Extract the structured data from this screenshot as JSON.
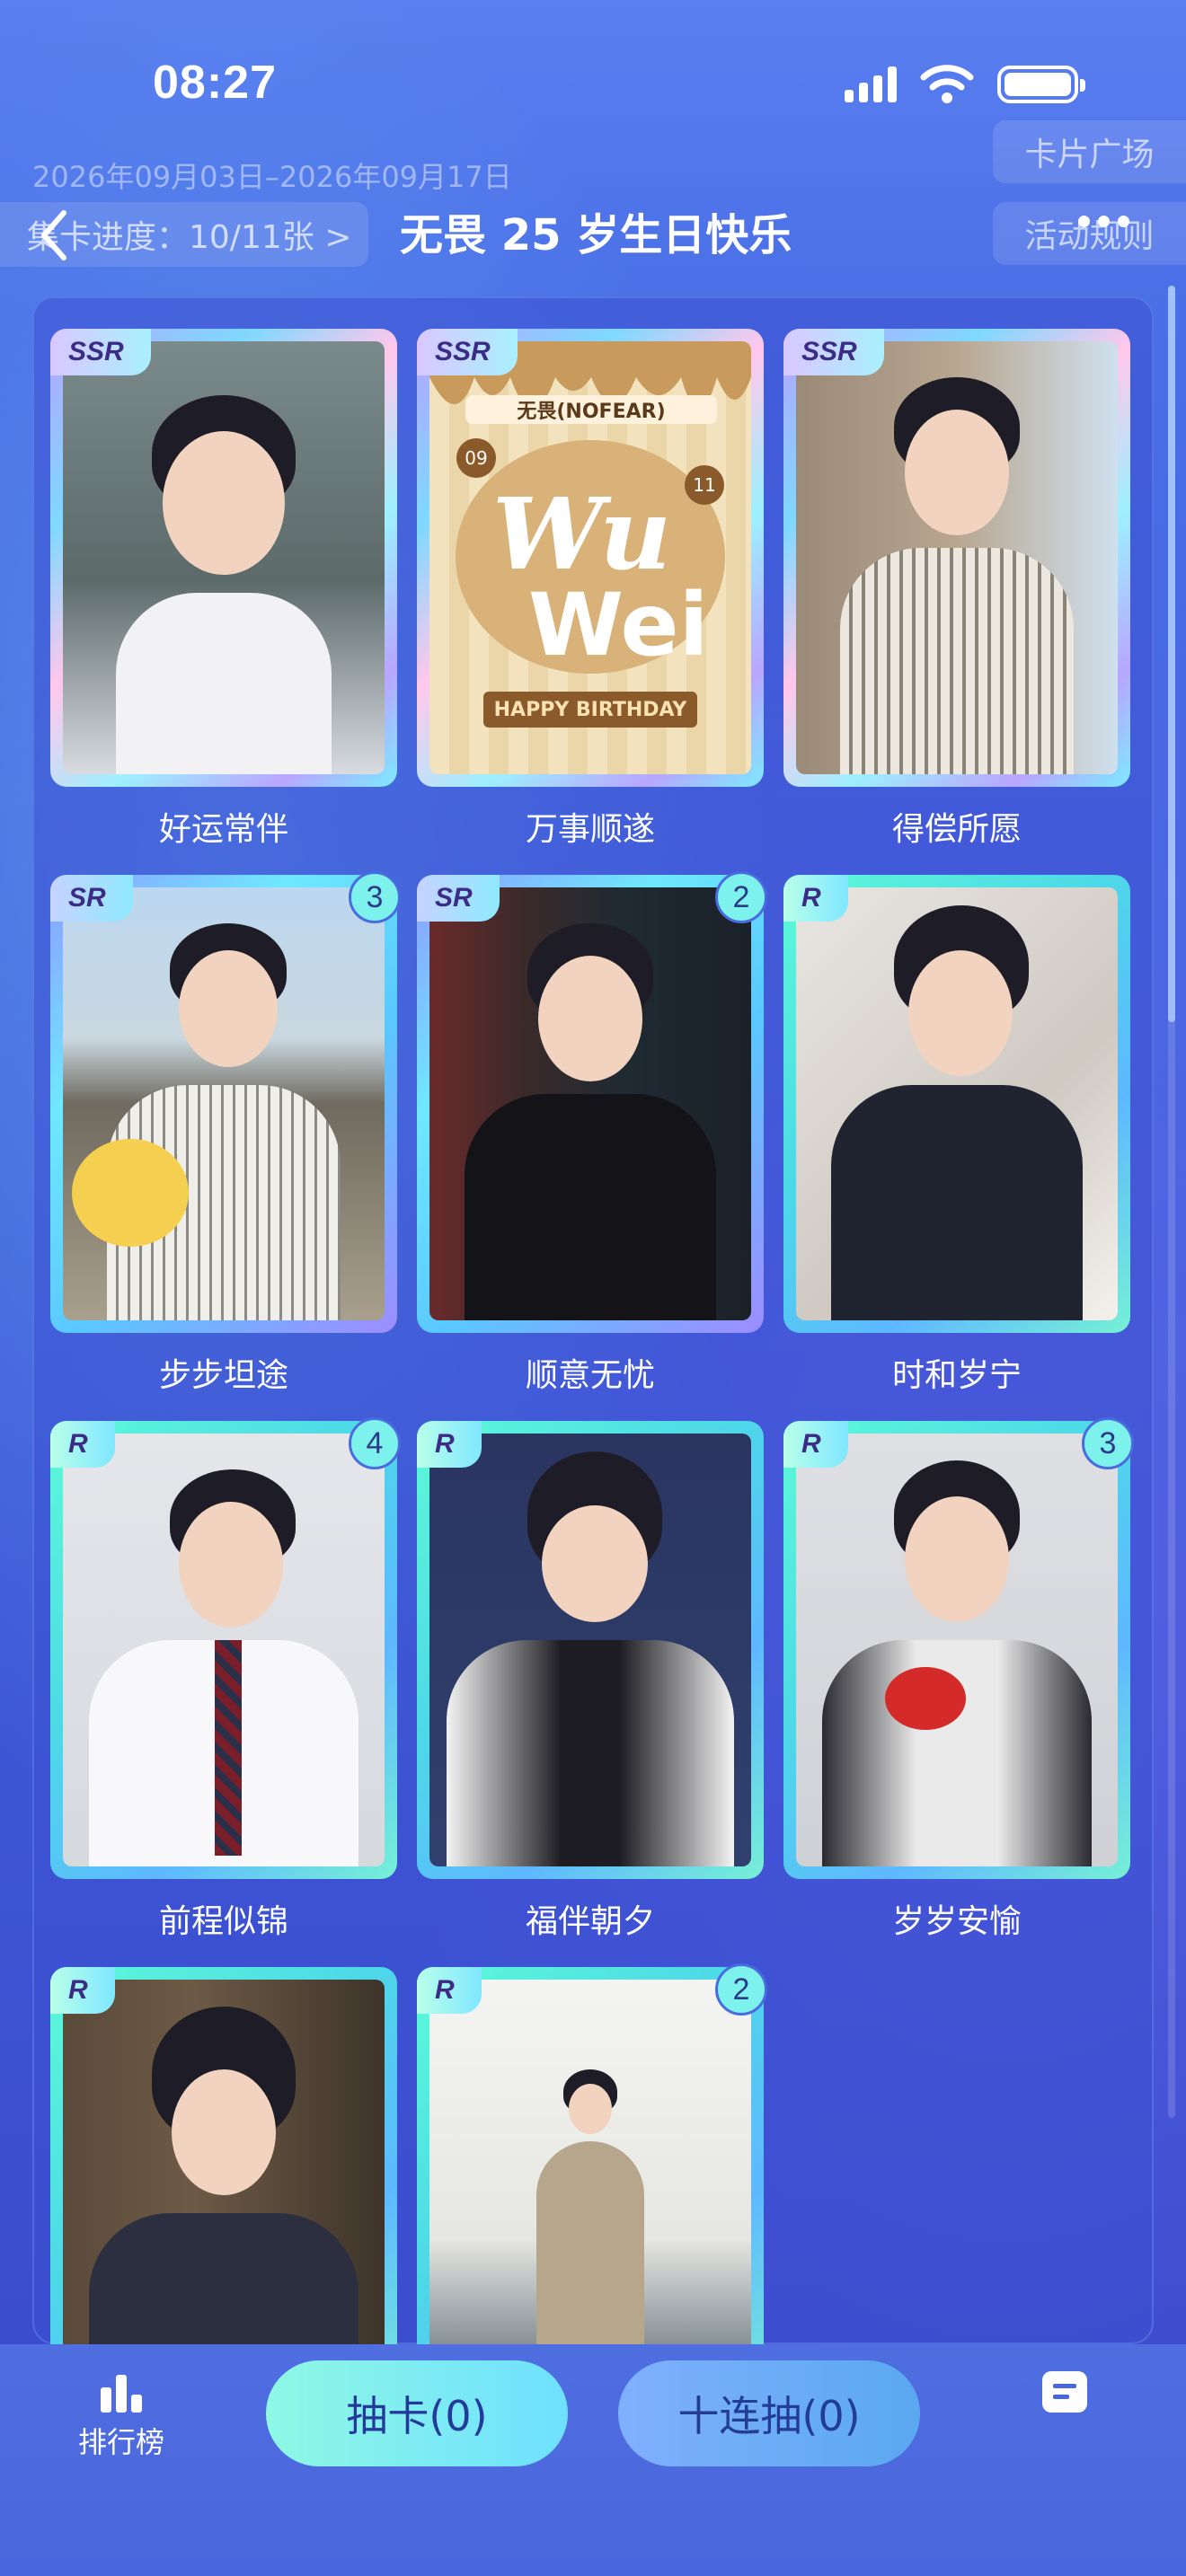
{
  "status": {
    "time": "08:27"
  },
  "header": {
    "date_range": "2026年09月03日–2026年09月17日",
    "progress": "集卡进度：10/11张 >",
    "title": "无畏 25 岁生日快乐",
    "plaza": "卡片广场",
    "rules": "活动规则"
  },
  "cards": [
    {
      "name": "好运常伴",
      "rarity": "SSR",
      "count": ""
    },
    {
      "name": "万事顺遂",
      "rarity": "SSR",
      "count": ""
    },
    {
      "name": "得偿所愿",
      "rarity": "SSR",
      "count": ""
    },
    {
      "name": "步步坦途",
      "rarity": "SR",
      "count": "3"
    },
    {
      "name": "顺意无忧",
      "rarity": "SR",
      "count": "2"
    },
    {
      "name": "时和岁宁",
      "rarity": "R",
      "count": ""
    },
    {
      "name": "前程似锦",
      "rarity": "R",
      "count": "4"
    },
    {
      "name": "福伴朝夕",
      "rarity": "R",
      "count": ""
    },
    {
      "name": "岁岁安愉",
      "rarity": "R",
      "count": "3"
    },
    {
      "name": "",
      "rarity": "R",
      "count": ""
    },
    {
      "name": "",
      "rarity": "R",
      "count": "2"
    }
  ],
  "special_card": {
    "top_text": "无畏(NOFEAR)",
    "num_left": "09",
    "num_right": "11",
    "word1": "Wu",
    "word2": "Wei",
    "banner": "HAPPY BIRTHDAY"
  },
  "bottom": {
    "rank_label": "排行榜",
    "draw_one": "抽卡(0)",
    "draw_ten": "十连抽(0)"
  },
  "colors": {
    "accent": "#7df2ec",
    "background": "#4a6fe6"
  },
  "icons": [
    "back-arrow-icon",
    "more-dots-icon",
    "ranking-icon",
    "note-icon",
    "signal-icon",
    "wifi-icon",
    "battery-icon"
  ]
}
